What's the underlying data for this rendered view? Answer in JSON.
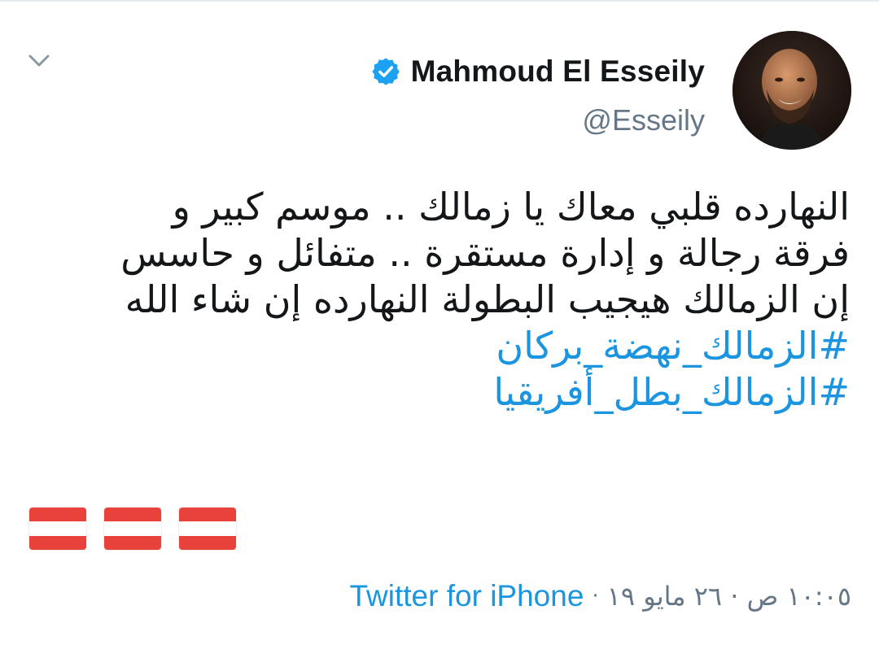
{
  "author": {
    "display_name": "Mahmoud El Esseily",
    "handle": "@Esseily",
    "verified_icon": "verified-badge-icon",
    "avatar_icon": "avatar-photo"
  },
  "tweet": {
    "lines": [
      "النهارده قلبي معاك يا زمالك .. موسم كبير و",
      "فرقة رجالة و إدارة مستقرة .. متفائل و حاسس",
      "إن الزمالك هيجيب البطولة النهارده إن شاء الله"
    ],
    "hashtags": [
      "#الزمالك_نهضة_بركان",
      "#الزمالك_بطل_أفريقيا"
    ],
    "flags": [
      "flag-emoji",
      "flag-emoji",
      "flag-emoji"
    ]
  },
  "meta": {
    "source": "Twitter for iPhone",
    "separator": "·",
    "time_text": "١٠:٠٥ ص · ٢٦ مايو ١٩"
  },
  "colors": {
    "link": "#1b95e0",
    "muted": "#657786",
    "text": "#14171a",
    "flag_red": "#e8423b"
  }
}
